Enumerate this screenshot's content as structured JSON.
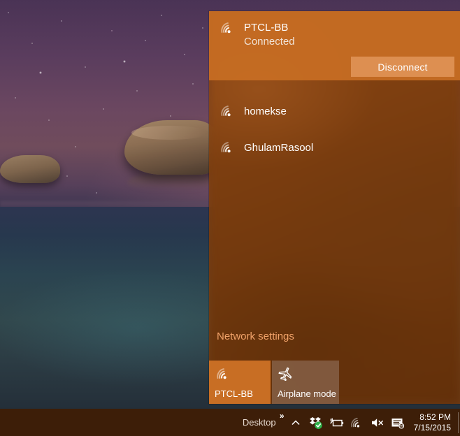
{
  "desktop": {
    "wallpaper_description": "starry night seascape with rocks"
  },
  "flyout": {
    "connected_network": {
      "name": "PTCL-BB",
      "status": "Connected",
      "icon": "wifi-icon",
      "disconnect_label": "Disconnect"
    },
    "available_networks": [
      {
        "name": "homekse",
        "icon": "wifi-icon"
      },
      {
        "name": "GhulamRasool",
        "icon": "wifi-icon"
      }
    ],
    "settings_link": "Network settings",
    "tiles": [
      {
        "label": "PTCL-BB",
        "icon": "wifi-icon",
        "state": "active"
      },
      {
        "label": "Airplane mode",
        "icon": "airplane-icon",
        "state": "inactive"
      }
    ],
    "colors": {
      "accent": "#c86e24",
      "panel": "#803e0e",
      "button": "#de9254",
      "link": "#f2a36a"
    }
  },
  "taskbar": {
    "desktop_label": "Desktop",
    "overflow_indicator": "»",
    "tray_icons": [
      "chevron-up-icon",
      "dropbox-icon",
      "battery-charging-icon",
      "wifi-icon",
      "speaker-muted-icon",
      "action-center-icon"
    ],
    "clock": {
      "time": "8:52 PM",
      "date": "7/15/2015"
    },
    "background_color": "#3d1e08"
  }
}
